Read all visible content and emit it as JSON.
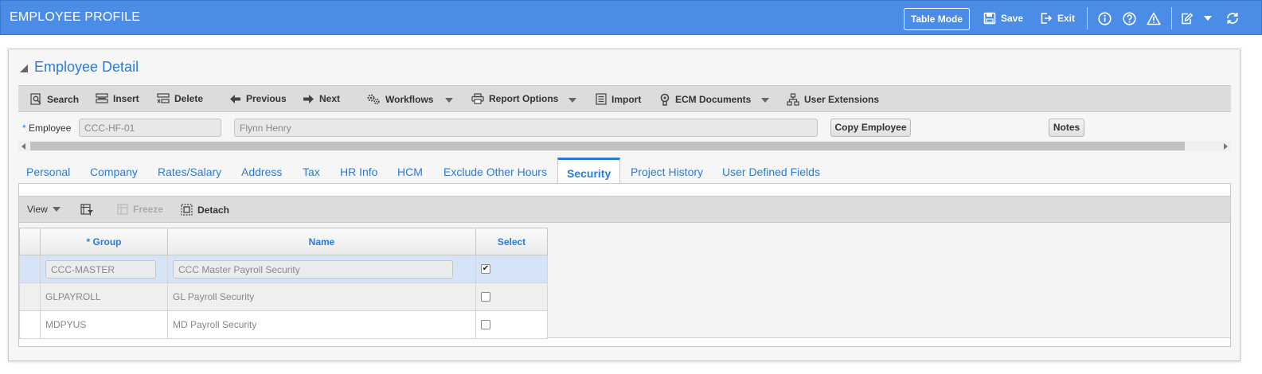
{
  "app": {
    "title": "EMPLOYEE PROFILE"
  },
  "titlebar": {
    "table_mode": "Table Mode",
    "save": "Save",
    "exit": "Exit",
    "icons": [
      "info-icon",
      "help-icon",
      "warning-icon",
      "edit-icon",
      "chevron-down-icon",
      "refresh-icon"
    ]
  },
  "section": {
    "title": "Employee Detail"
  },
  "toolbar": {
    "search": "Search",
    "insert": "Insert",
    "delete": "Delete",
    "previous": "Previous",
    "next": "Next",
    "workflows": "Workflows",
    "report_options": "Report Options",
    "import": "Import",
    "ecm_documents": "ECM Documents",
    "user_extensions": "User Extensions"
  },
  "employee": {
    "required_mark": "*",
    "label": "Employee",
    "id": "CCC-HF-01",
    "name": "Flynn Henry",
    "copy_button": "Copy Employee",
    "notes_button": "Notes"
  },
  "tabs": [
    {
      "label": "Personal"
    },
    {
      "label": "Company"
    },
    {
      "label": "Rates/Salary"
    },
    {
      "label": "Address"
    },
    {
      "label": "Tax"
    },
    {
      "label": "HR Info"
    },
    {
      "label": "HCM"
    },
    {
      "label": "Exclude Other Hours"
    },
    {
      "label": "Security"
    },
    {
      "label": "Project History"
    },
    {
      "label": "User Defined Fields"
    }
  ],
  "active_tab": "Security",
  "grid_toolbar": {
    "view": "View",
    "freeze": "Freeze",
    "detach": "Detach"
  },
  "grid": {
    "columns": {
      "group": "* Group",
      "name": "Name",
      "select": "Select"
    },
    "rows": [
      {
        "group": "CCC-MASTER",
        "name": "CCC Master Payroll Security",
        "selected": true
      },
      {
        "group": "GLPAYROLL",
        "name": "GL Payroll Security",
        "selected": false
      },
      {
        "group": "MDPYUS",
        "name": "MD Payroll Security",
        "selected": false
      }
    ]
  },
  "colors": {
    "titlebar": "#4a8ce6",
    "accent": "#2c7bd8",
    "selected_row": "#d6e4f8"
  }
}
